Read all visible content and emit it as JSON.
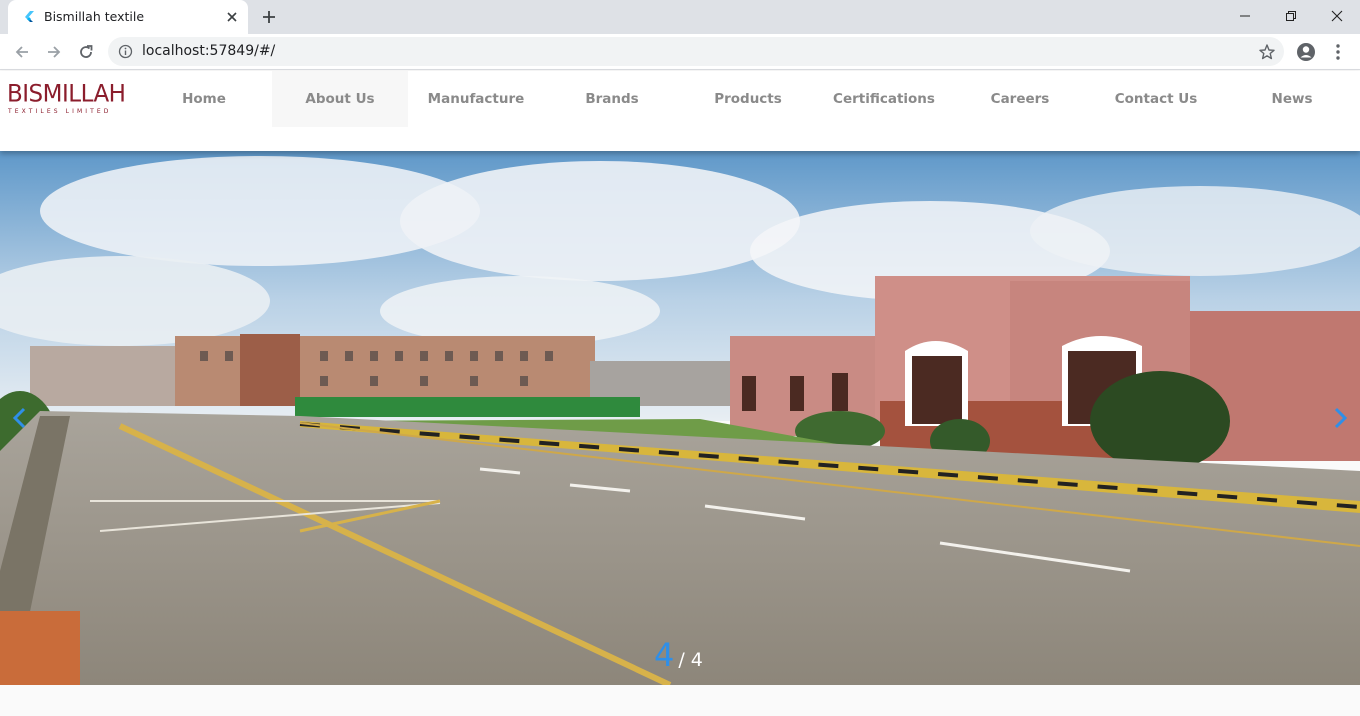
{
  "browser": {
    "tab_title": "Bismillah textile",
    "url": "localhost:57849/#/"
  },
  "site": {
    "logo_main": "BISMILLAH",
    "logo_sub": "TEXTILES LIMITED",
    "nav": [
      {
        "label": "Home"
      },
      {
        "label": "About Us"
      },
      {
        "label": "Manufacture"
      },
      {
        "label": "Brands"
      },
      {
        "label": "Products"
      },
      {
        "label": "Certifications"
      },
      {
        "label": "Careers"
      },
      {
        "label": "Contact Us"
      },
      {
        "label": "News"
      }
    ]
  },
  "slider": {
    "current": "4",
    "total": "/ 4",
    "accent_color": "#2f8fe8"
  }
}
